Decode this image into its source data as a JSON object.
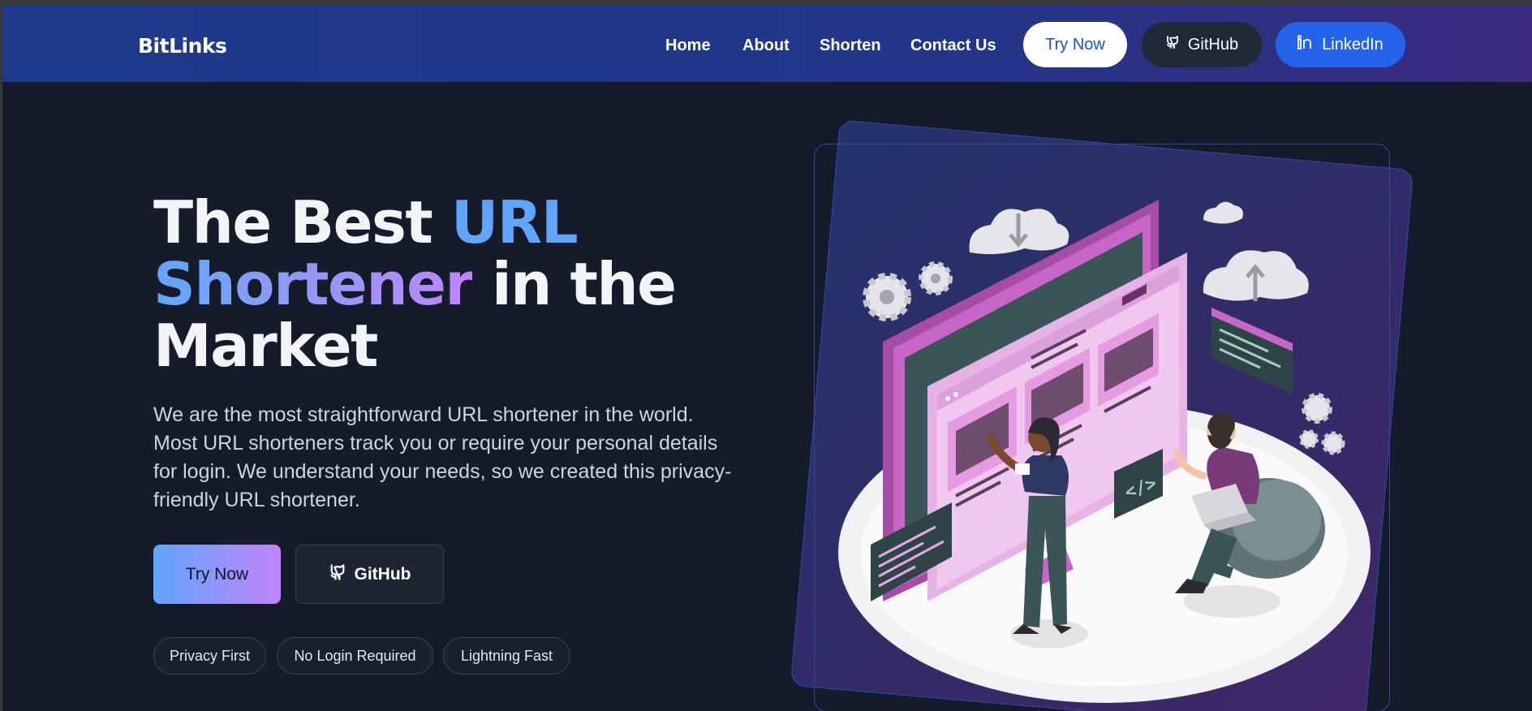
{
  "navbar": {
    "brand": "BitLinks",
    "links": [
      {
        "label": "Home"
      },
      {
        "label": "About"
      },
      {
        "label": "Shorten"
      },
      {
        "label": "Contact Us"
      }
    ],
    "try_label": "Try Now",
    "github_label": "GitHub",
    "linkedin_label": "LinkedIn"
  },
  "hero": {
    "title_part1": "The Best ",
    "title_part2": "URL",
    "title_part3": "Shortener",
    "title_part4": " in the",
    "title_part5": "Market",
    "description": "We are the most straightforward URL shortener in the world. Most URL shorteners track you or require your personal details for login. We understand your needs, so we created this privacy-friendly URL shortener.",
    "try_label": "Try Now",
    "github_label": "GitHub",
    "features": [
      "Privacy First",
      "No Login Required",
      "Lightning Fast"
    ]
  },
  "illustration": {
    "code_tag": "</>"
  },
  "colors": {
    "nav_bg": "#1e3a8a",
    "page_bg": "#151b2b",
    "accent_blue": "#60a5fa",
    "accent_purple": "#c084fc",
    "linkedin_bg": "#2563eb"
  }
}
